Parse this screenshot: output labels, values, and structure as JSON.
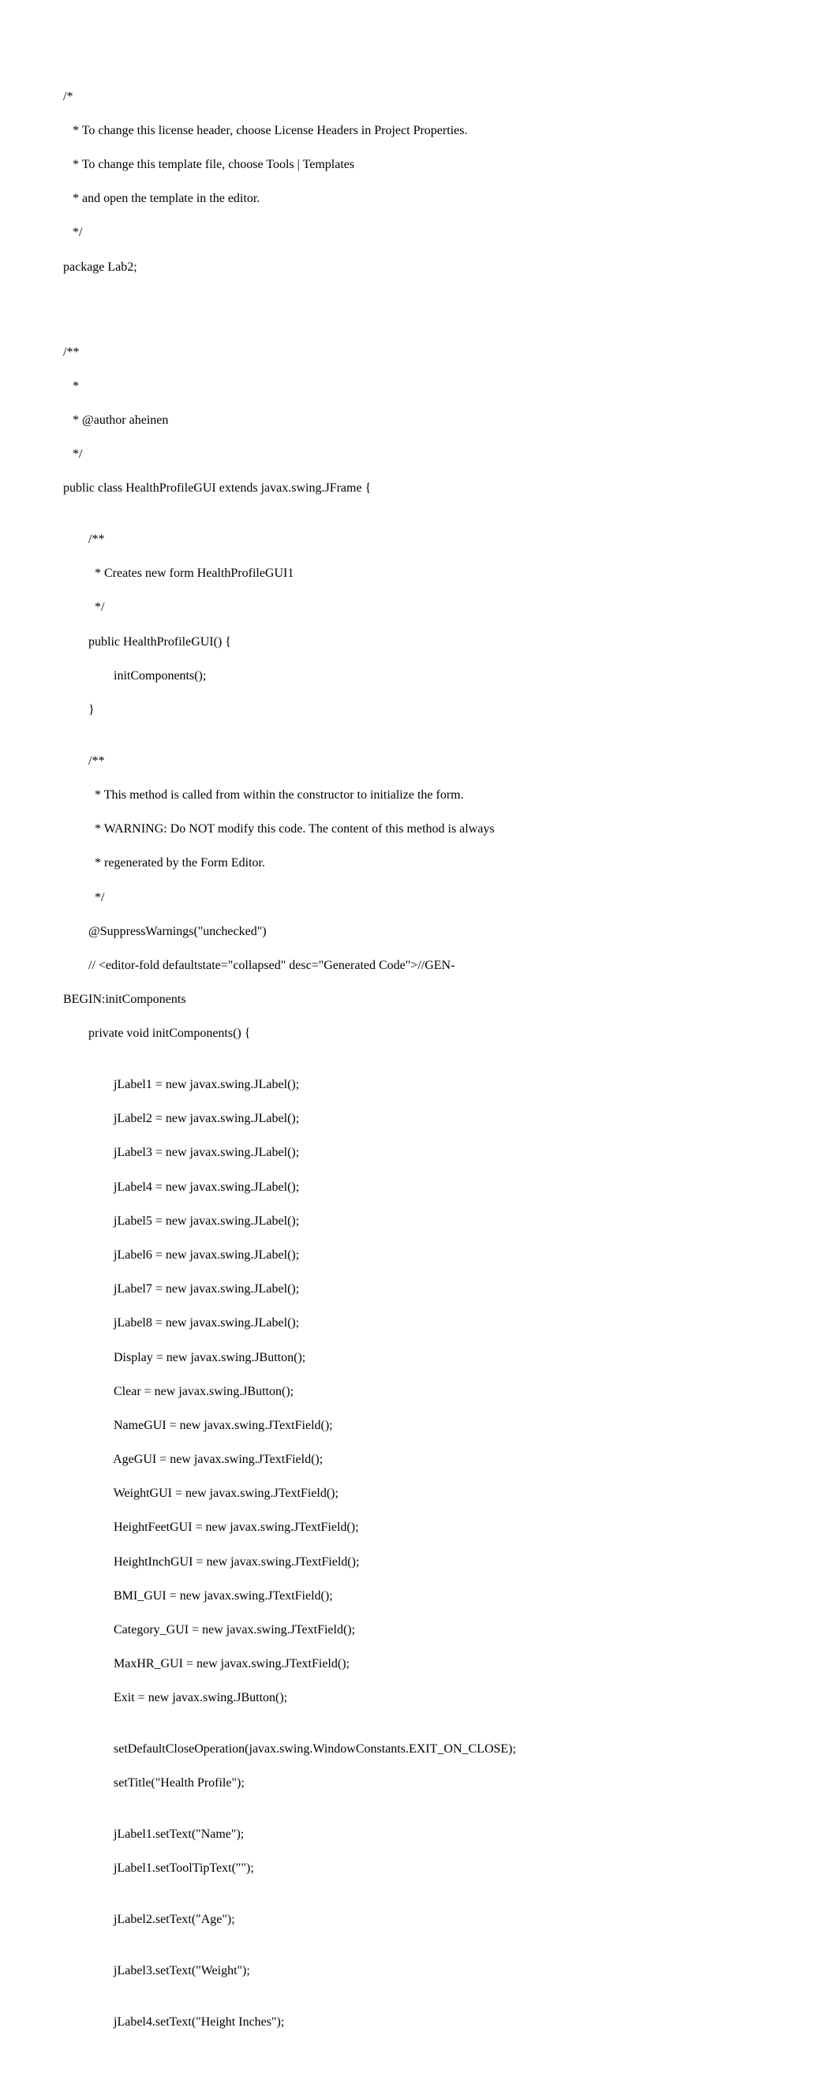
{
  "code": {
    "lines": [
      "/*",
      "   * To change this license header, choose License Headers in Project Properties.",
      "   * To change this template file, choose Tools | Templates",
      "   * and open the template in the editor.",
      "   */",
      "package Lab2;",
      "",
      "",
      "",
      "/**",
      "   *",
      "   * @author aheinen",
      "   */",
      "public class HealthProfileGUI extends javax.swing.JFrame {",
      "",
      "        /**",
      "          * Creates new form HealthProfileGUI1",
      "          */",
      "        public HealthProfileGUI() {",
      "                initComponents();",
      "        }",
      "",
      "        /**",
      "          * This method is called from within the constructor to initialize the form.",
      "          * WARNING: Do NOT modify this code. The content of this method is always",
      "          * regenerated by the Form Editor.",
      "          */",
      "        @SuppressWarnings(\"unchecked\")",
      "        // <editor-fold defaultstate=\"collapsed\" desc=\"Generated Code\">//GEN-",
      "BEGIN:initComponents",
      "        private void initComponents() {",
      "",
      "                jLabel1 = new javax.swing.JLabel();",
      "                jLabel2 = new javax.swing.JLabel();",
      "                jLabel3 = new javax.swing.JLabel();",
      "                jLabel4 = new javax.swing.JLabel();",
      "                jLabel5 = new javax.swing.JLabel();",
      "                jLabel6 = new javax.swing.JLabel();",
      "                jLabel7 = new javax.swing.JLabel();",
      "                jLabel8 = new javax.swing.JLabel();",
      "                Display = new javax.swing.JButton();",
      "                Clear = new javax.swing.JButton();",
      "                NameGUI = new javax.swing.JTextField();",
      "                AgeGUI = new javax.swing.JTextField();",
      "                WeightGUI = new javax.swing.JTextField();",
      "                HeightFeetGUI = new javax.swing.JTextField();",
      "                HeightInchGUI = new javax.swing.JTextField();",
      "                BMI_GUI = new javax.swing.JTextField();",
      "                Category_GUI = new javax.swing.JTextField();",
      "                MaxHR_GUI = new javax.swing.JTextField();",
      "                Exit = new javax.swing.JButton();",
      "",
      "                setDefaultCloseOperation(javax.swing.WindowConstants.EXIT_ON_CLOSE);",
      "                setTitle(\"Health Profile\");",
      "",
      "                jLabel1.setText(\"Name\");",
      "                jLabel1.setToolTipText(\"\");",
      "",
      "                jLabel2.setText(\"Age\");",
      "",
      "                jLabel3.setText(\"Weight\");",
      "",
      "                jLabel4.setText(\"Height Inches\");"
    ]
  }
}
